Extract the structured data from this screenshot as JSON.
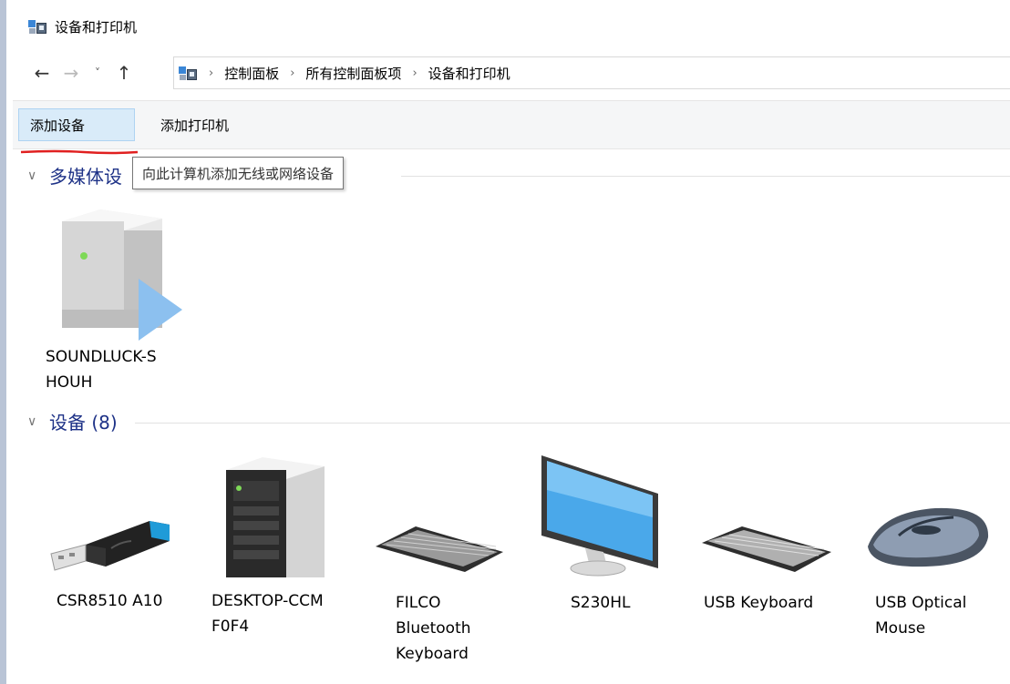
{
  "window": {
    "title": "设备和打印机"
  },
  "nav": {
    "back_icon": "←",
    "forward_icon": "→",
    "recent_icon": "˅",
    "up_icon": "↑",
    "breadcrumb": [
      "控制面板",
      "所有控制面板项",
      "设备和打印机"
    ],
    "separator": "›"
  },
  "commandbar": {
    "add_device": "添加设备",
    "add_printer": "添加打印机"
  },
  "tooltip": {
    "text": "向此计算机添加无线或网络设备"
  },
  "groups": {
    "multimedia": {
      "label": "多媒体设",
      "chevron": "∨"
    },
    "devices": {
      "label": "设备 (8)",
      "chevron": "∨"
    }
  },
  "multimedia_devices": [
    {
      "name": "SOUNDLUCK-S\nHOUH",
      "icon": "media-server-icon"
    }
  ],
  "devices": [
    {
      "name": "CSR8510 A10",
      "icon": "usb-dongle-icon"
    },
    {
      "name": "DESKTOP-CCM\nF0F4",
      "icon": "desktop-tower-icon"
    },
    {
      "name": "FILCO\nBluetooth\nKeyboard",
      "icon": "keyboard-icon"
    },
    {
      "name": "S230HL",
      "icon": "monitor-icon"
    },
    {
      "name": "USB Keyboard",
      "icon": "keyboard-icon"
    },
    {
      "name": "USB Optical\nMouse",
      "icon": "mouse-icon"
    }
  ],
  "colors": {
    "group_header": "#1e3287",
    "selected_button_bg": "#d9ebf9",
    "annotation_red": "#e02020"
  }
}
